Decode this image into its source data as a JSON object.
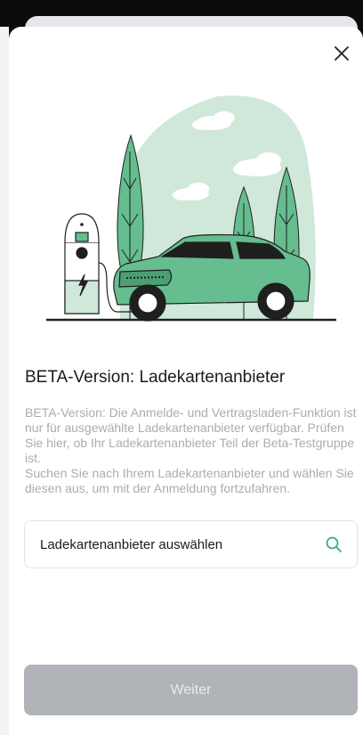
{
  "dialog": {
    "title": "BETA-Version: Ladekartenanbieter",
    "description": [
      "BETA-Version: Die Anmelde- und Vertragsladen-Funktion ist nur für ausgewählte Ladekartenanbieter verfügbar. Prüfen Sie hier, ob Ihr Ladekartenanbieter Teil der Beta-Testgruppe ist.",
      "Suchen Sie nach Ihrem Ladekartenanbieter und wählen Sie diesen aus, um mit der Anmeldung fortzufahren."
    ],
    "search_label": "Ladekartenanbieter auswählen",
    "search_icon": "search-icon",
    "close_icon": "close-icon",
    "continue_label": "Weiter"
  },
  "colors": {
    "accent": "#3fa882",
    "illustration_green": "#66bd8f",
    "illustration_light": "#cfe8da",
    "button_disabled": "#b0b3b7",
    "text_primary": "#1b1b1b",
    "text_secondary": "#a9acb1"
  }
}
